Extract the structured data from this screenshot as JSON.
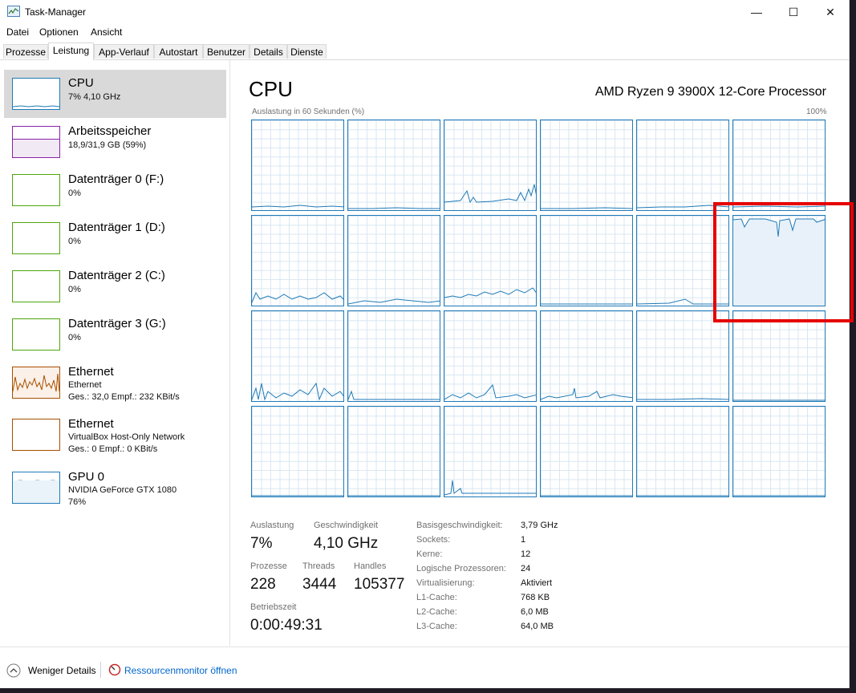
{
  "window": {
    "title": "Task-Manager",
    "minimize": "—",
    "maximize": "☐",
    "close": "✕"
  },
  "menu": [
    "Datei",
    "Optionen",
    "Ansicht"
  ],
  "tabs": [
    "Prozesse",
    "Leistung",
    "App-Verlauf",
    "Autostart",
    "Benutzer",
    "Details",
    "Dienste"
  ],
  "active_tab": "Leistung",
  "sidebar": [
    {
      "title": "CPU",
      "sub1": "7% 4,10 GHz",
      "sub2": "",
      "sub3": "",
      "color": "#1f7ab8"
    },
    {
      "title": "Arbeitsspeicher",
      "sub1": "18,9/31,9 GB (59%)",
      "sub2": "",
      "sub3": "",
      "color": "#8b21a8"
    },
    {
      "title": "Datenträger 0 (F:)",
      "sub1": "0%",
      "sub2": "",
      "sub3": "",
      "color": "#4da60c"
    },
    {
      "title": "Datenträger 1 (D:)",
      "sub1": "0%",
      "sub2": "",
      "sub3": "",
      "color": "#4da60c"
    },
    {
      "title": "Datenträger 2 (C:)",
      "sub1": "0%",
      "sub2": "",
      "sub3": "",
      "color": "#4da60c"
    },
    {
      "title": "Datenträger 3 (G:)",
      "sub1": "0%",
      "sub2": "",
      "sub3": "",
      "color": "#4da60c"
    },
    {
      "title": "Ethernet",
      "sub1": "Ethernet",
      "sub2": "Ges.: 32,0 Empf.: 232 KBit/s",
      "sub3": "",
      "color": "#a74f01"
    },
    {
      "title": "Ethernet",
      "sub1": "VirtualBox Host-Only Network",
      "sub2": "Ges.: 0 Empf.: 0 KBit/s",
      "sub3": "",
      "color": "#a74f01"
    },
    {
      "title": "GPU 0",
      "sub1": "NVIDIA GeForce GTX 1080",
      "sub2": "76%",
      "sub3": "",
      "color": "#1f7ab8"
    }
  ],
  "main": {
    "title": "CPU",
    "processor": "AMD Ryzen 9 3900X 12-Core Processor",
    "graph_label": "Auslastung in 60 Sekunden (%)",
    "graph_max": "100%",
    "accent": "#1f7ab8"
  },
  "stats": {
    "auslastung_label": "Auslastung",
    "auslastung": "7%",
    "geschwindigkeit_label": "Geschwindigkeit",
    "geschwindigkeit": "4,10 GHz",
    "prozesse_label": "Prozesse",
    "prozesse": "228",
    "threads_label": "Threads",
    "threads": "3444",
    "handles_label": "Handles",
    "handles": "105377",
    "betriebszeit_label": "Betriebszeit",
    "betriebszeit": "0:00:49:31"
  },
  "specs": [
    {
      "label": "Basisgeschwindigkeit:",
      "value": "3,79 GHz"
    },
    {
      "label": "Sockets:",
      "value": "1"
    },
    {
      "label": "Kerne:",
      "value": "12"
    },
    {
      "label": "Logische Prozessoren:",
      "value": "24"
    },
    {
      "label": "Virtualisierung:",
      "value": "Aktiviert"
    },
    {
      "label": "L1-Cache:",
      "value": "768 KB"
    },
    {
      "label": "L2-Cache:",
      "value": "6,0 MB"
    },
    {
      "label": "L3-Cache:",
      "value": "64,0 MB"
    }
  ],
  "footer": {
    "fewer_details": "Weniger Details",
    "resource_monitor": "Ressourcenmonitor öffnen"
  }
}
